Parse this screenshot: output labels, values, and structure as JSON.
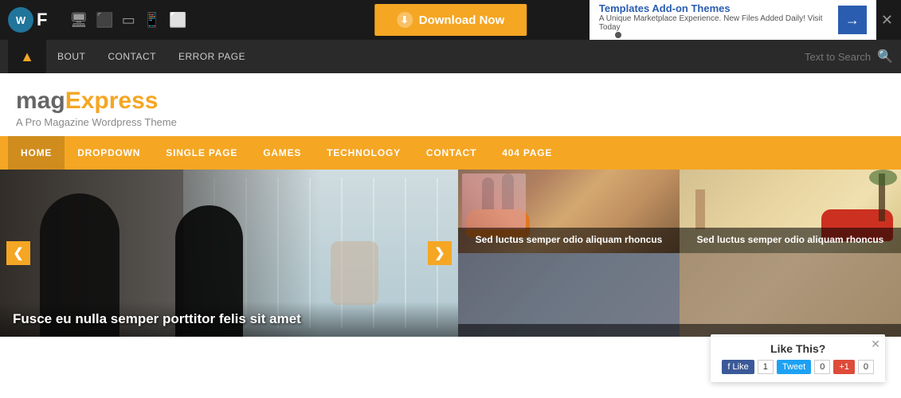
{
  "topBar": {
    "logo": "WpF",
    "wp_text": "Wp",
    "f_text": "F",
    "download_btn": "Download Now",
    "ad_title": "Templates Add-on Themes",
    "ad_desc": "A Unique Marketplace Experience. New Files Added Daily! Visit Today"
  },
  "navBar": {
    "up_arrow": "▲",
    "links": [
      "BOUT",
      "CONTACT",
      "ERROR PAGE"
    ],
    "search_placeholder": "Text to Search"
  },
  "logo": {
    "mag": "mag",
    "express": "Express",
    "tagline": "A Pro Magazine Wordpress Theme"
  },
  "mainNav": {
    "items": [
      "HOME",
      "DROPDOWN",
      "SINGLE PAGE",
      "GAMES",
      "TECHNOLOGY",
      "CONTACT",
      "404 PAGE"
    ]
  },
  "slider": {
    "caption": "Fusce eu nulla semper porttitor felis sit amet",
    "prev": "❮",
    "next": "❯"
  },
  "sideCards": [
    {
      "caption": "Sed luctus semper odio aliquam rhoncus"
    },
    {
      "caption": "Sed luctus semper odio aliquam rhoncus"
    },
    {
      "caption": ""
    },
    {
      "caption": ""
    }
  ],
  "socialBar": {
    "like_this": "Like This?",
    "fb_label": "Like",
    "fb_count": "1",
    "tw_label": "Tweet",
    "tw_count": "0",
    "gp_label": "+1",
    "gp_count": "0"
  },
  "icons": {
    "desktop": "🖥",
    "tablet_landscape": "⬛",
    "tablet_portrait": "▭",
    "mobile": "📱",
    "small_screen": "⬜",
    "search": "🔍",
    "download_arrow": "⬇",
    "ad_arrow": "→",
    "close": "✕"
  }
}
